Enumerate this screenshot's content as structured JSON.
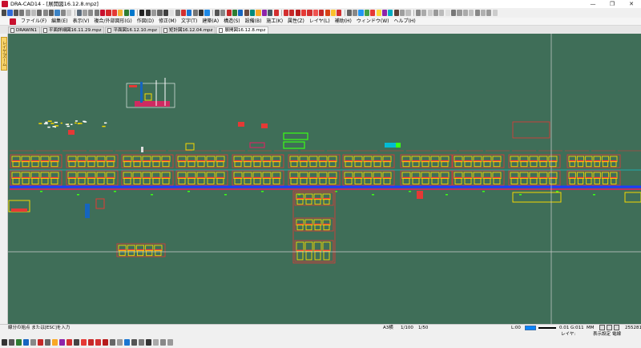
{
  "window": {
    "title": "DRA-CAD14 - [展開図16.12.8.mpz]",
    "controls": [
      "—",
      "❐",
      "✕"
    ]
  },
  "toolbar_colors": [
    "#4a4a4a",
    "#2f6bd8",
    "#555",
    "#777",
    "#999",
    "#bbb",
    "#6a6a6a",
    "#888",
    "#5a5a5a",
    "#3b82c4",
    "#888",
    "#ccc",
    "sep",
    "#5b6b7b",
    "#a0a0a0",
    "#8b8b8b",
    "#7a7a7a",
    "#c8102e",
    "#d62828",
    "#e53935",
    "#f3b233",
    "#2e7d32",
    "#0077cc",
    "sep",
    "#222",
    "#333",
    "#999",
    "#666",
    "#404040",
    "#e0e0e0",
    "#777",
    "#d32f2f",
    "#1976d2",
    "#757575",
    "#333",
    "#1e88e5",
    "sep",
    "#555",
    "#888",
    "#c62828",
    "#2e7d32",
    "#1565c0",
    "#6d4c41",
    "#00897b",
    "#f9a825",
    "#8e24aa",
    "#455a64",
    "#d32f2f",
    "sep",
    "#d32f2f",
    "#c62828",
    "#b71c1c",
    "#e53935",
    "#d32f2f",
    "#ef5350",
    "#c62828",
    "#d84315",
    "#fbc02d",
    "#d32f2f",
    "sep",
    "#666",
    "#888",
    "#2196f3",
    "#43a047",
    "#e53935",
    "#fdd835",
    "#8e24aa",
    "#00acc1",
    "#5d4037",
    "#9e9e9e",
    "#bdbdbd",
    "sep",
    "#888",
    "#aaa",
    "#ccc",
    "#999",
    "#bbb",
    "#e0e0e0",
    "#777",
    "#999",
    "#aaa",
    "#c0c0c0",
    "#888",
    "#b0b0b0",
    "#999",
    "#ccc"
  ],
  "menu": [
    "ファイル(F)",
    "編集(E)",
    "表示(V)",
    "複合/外部図形(G)",
    "作図(D)",
    "修正(M)",
    "文字(T)",
    "建築(A)",
    "構造(S)",
    "設備(B)",
    "施工(K)",
    "属性(Z)",
    "レイヤ(L)",
    "補助(H)",
    "ウィンドウ(W)",
    "ヘルプ(H)"
  ],
  "tabs": [
    {
      "label": "DRAWIN1",
      "active": false
    },
    {
      "label": "平面詳細図16.11.29.mpz",
      "active": false
    },
    {
      "label": "平面図16.12.10.mpz",
      "active": false
    },
    {
      "label": "矩計図16.12.04.mpz",
      "active": false
    },
    {
      "label": "展開図16.12.8.mpz",
      "active": true
    }
  ],
  "side_panel": {
    "label": "レイヤ/ズーム"
  },
  "status": {
    "prompt": "線分の始点  または[ESC]を入力",
    "paper": "A3横",
    "scale1": "1/100",
    "scale2": "1/50",
    "zoom_label": "L:00",
    "line_width": "0.01",
    "grid": "G:011",
    "unit": "MM",
    "layer": "レイヤ:",
    "display": "表示設定",
    "edit": "電線",
    "count": "255281"
  },
  "bottom_colors": [
    "#333",
    "#555",
    "#2e7d32",
    "#1565c0",
    "#888",
    "#c62828",
    "#666",
    "#f9a825",
    "#8e24aa",
    "#d32f2f",
    "#444",
    "#e53935",
    "#c62828",
    "#d32f2f",
    "#b71c1c",
    "#666",
    "#999",
    "#1976d2",
    "#555",
    "#777",
    "#333",
    "#aaa",
    "#888",
    "#999"
  ],
  "canvas": {
    "background": "#3f6e58",
    "crosshair_color": "#cfcfcf",
    "cursor_mark_color": "#e0e0e0"
  }
}
